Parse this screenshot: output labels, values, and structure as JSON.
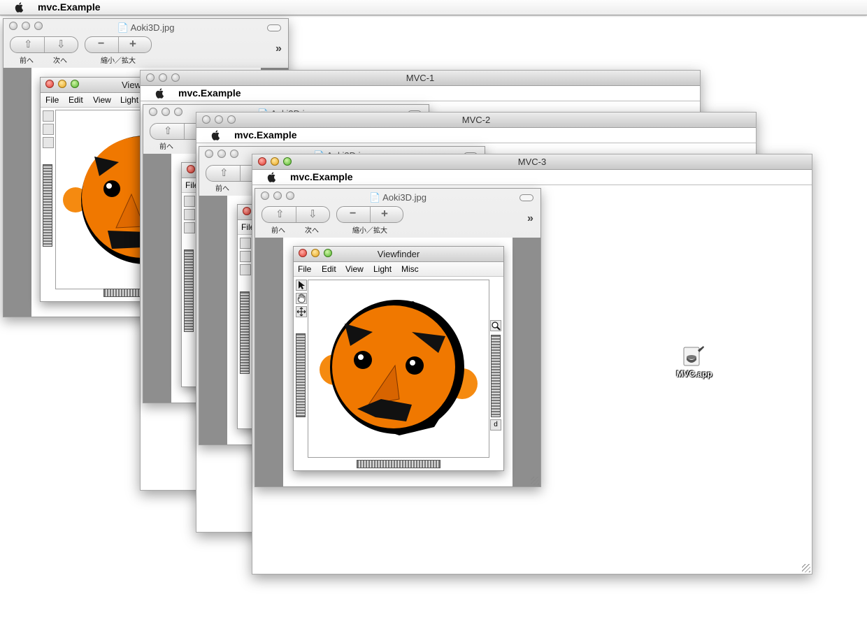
{
  "menubar": {
    "app_name": "mvc.Example"
  },
  "preview": {
    "file_title": "Aoki3D.jpg",
    "back_label": "前へ",
    "next_label": "次へ",
    "zoom_label": "縮小／拡大",
    "more": "»"
  },
  "windows": {
    "mvc1": {
      "title": "MVC-1",
      "app_name": "mvc.Example"
    },
    "mvc2": {
      "title": "MVC-2",
      "app_name": "mvc.Example"
    },
    "mvc3": {
      "title": "MVC-3",
      "app_name": "mvc.Example"
    }
  },
  "viewfinder": {
    "title": "Viewfinder",
    "title_partial": "View",
    "menu": [
      "File",
      "Edit",
      "View",
      "Light",
      "Misc"
    ],
    "menu_partial": "File",
    "zoom_d": "d"
  },
  "desktop": {
    "icon_label": "MVC.app",
    "icon": "application-icon"
  },
  "colors": {
    "face": "#f07800",
    "ears": "#f58a10",
    "pane": "#8e8e8e"
  }
}
